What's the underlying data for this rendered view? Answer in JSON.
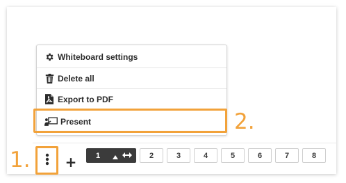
{
  "menu": {
    "items": [
      {
        "label": "Whiteboard settings",
        "icon": "gear-icon"
      },
      {
        "label": "Delete all",
        "icon": "trash-icon"
      },
      {
        "label": "Export to PDF",
        "icon": "pdf-file-icon"
      },
      {
        "label": "Present",
        "icon": "presentation-icon"
      }
    ]
  },
  "callouts": {
    "step1": "1.",
    "step2": "2."
  },
  "toolbar": {
    "more_icon": "kebab-menu-icon",
    "add_label": "+",
    "current_page": "1",
    "pages": [
      "2",
      "3",
      "4",
      "5",
      "6",
      "7",
      "8"
    ]
  },
  "colors": {
    "highlight": "#f2a23a",
    "active_page_bg": "#3b3b3b",
    "text": "#2b2b2b"
  }
}
